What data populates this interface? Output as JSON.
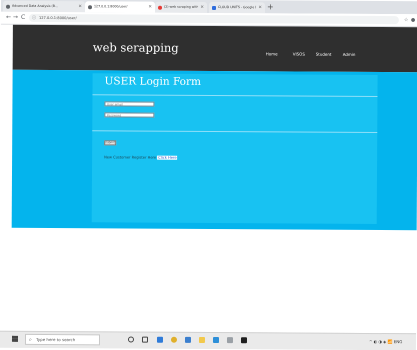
{
  "browser": {
    "tabs": [
      {
        "title": "Advanced Data Analysis (B...",
        "active": false,
        "icon_color": "#5f6368"
      },
      {
        "title": "127.0.0.1:8000/user/",
        "active": true,
        "icon_color": "#5f6368"
      },
      {
        "title": "(2) web scraping with python ...",
        "active": false,
        "icon_color": "#e53935"
      },
      {
        "title": "CLOUD UNITS - Google Docs",
        "active": false,
        "icon_color": "#2f6ddd"
      }
    ],
    "new_tab_symbol": "+",
    "address": "127.0.0.1:8000/user/",
    "back_symbol": "←",
    "forward_symbol": "→",
    "reload_symbol": "C"
  },
  "site": {
    "logo": "web serapping",
    "nav": [
      "Home",
      "VISOS",
      "Student",
      "Admin"
    ]
  },
  "form": {
    "title": "USER Login Form",
    "email_placeholder": "User email",
    "password_placeholder": "Password",
    "submit_label": "submit",
    "register_text": "New Customer Register Here",
    "register_link": "Click Here"
  },
  "taskbar": {
    "search_placeholder": "Type here to search",
    "tray_text": "^ ◐ ◑ ◈ 📶 ENG"
  }
}
